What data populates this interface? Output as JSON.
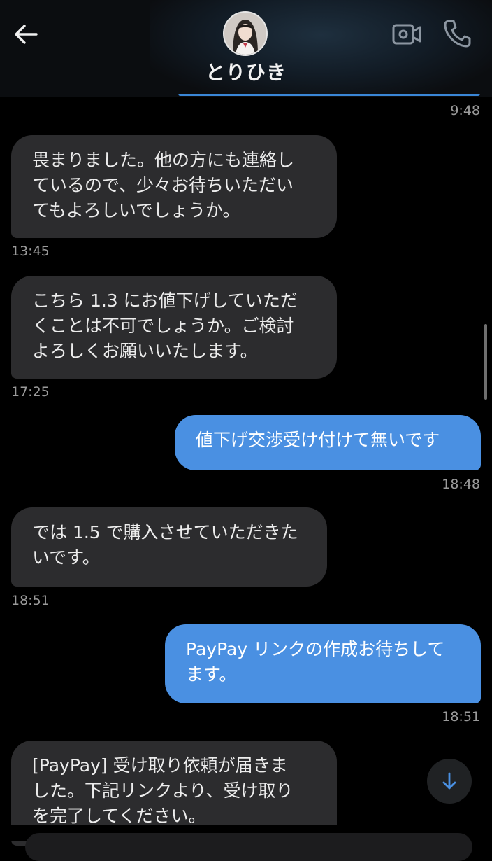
{
  "header": {
    "contact_name": "とりひき",
    "icons": {
      "back": "back-arrow-icon",
      "video": "video-call-icon",
      "phone": "phone-call-icon",
      "avatar": "profile-avatar"
    }
  },
  "messages": [
    {
      "direction": "out",
      "text": "",
      "time": "9:48"
    },
    {
      "direction": "in",
      "text": "畏まりました。他の方にも連絡し\nているので、少々お待ちいただい\nてもよろしいでしょうか。",
      "time": "13:45"
    },
    {
      "direction": "in",
      "text": "こちら 1.3 にお値下げしていただ\nくことは不可でしょうか。ご検討\nよろしくお願いいたします。",
      "time": "17:25"
    },
    {
      "direction": "out",
      "text": "値下げ交渉受け付けて無いです",
      "time": "18:48"
    },
    {
      "direction": "in",
      "text": "では 1.5 で購入させていただきた\nいです。",
      "time": "18:51"
    },
    {
      "direction": "out",
      "text": "PayPay リンクの作成お待ちして\nます。",
      "time": "18:51"
    },
    {
      "direction": "in",
      "text": "[PayPay] 受け取り依頼が届きま\nした。下記リンクより、受け取り\nを完了してください。",
      "time": ""
    }
  ],
  "controls": {
    "scroll_down_icon": "arrow-down-icon"
  },
  "colors": {
    "background": "#000000",
    "incoming_bubble": "#2c2c2e",
    "outgoing_bubble": "#4a90e2",
    "timestamp": "#9a9a9a"
  }
}
